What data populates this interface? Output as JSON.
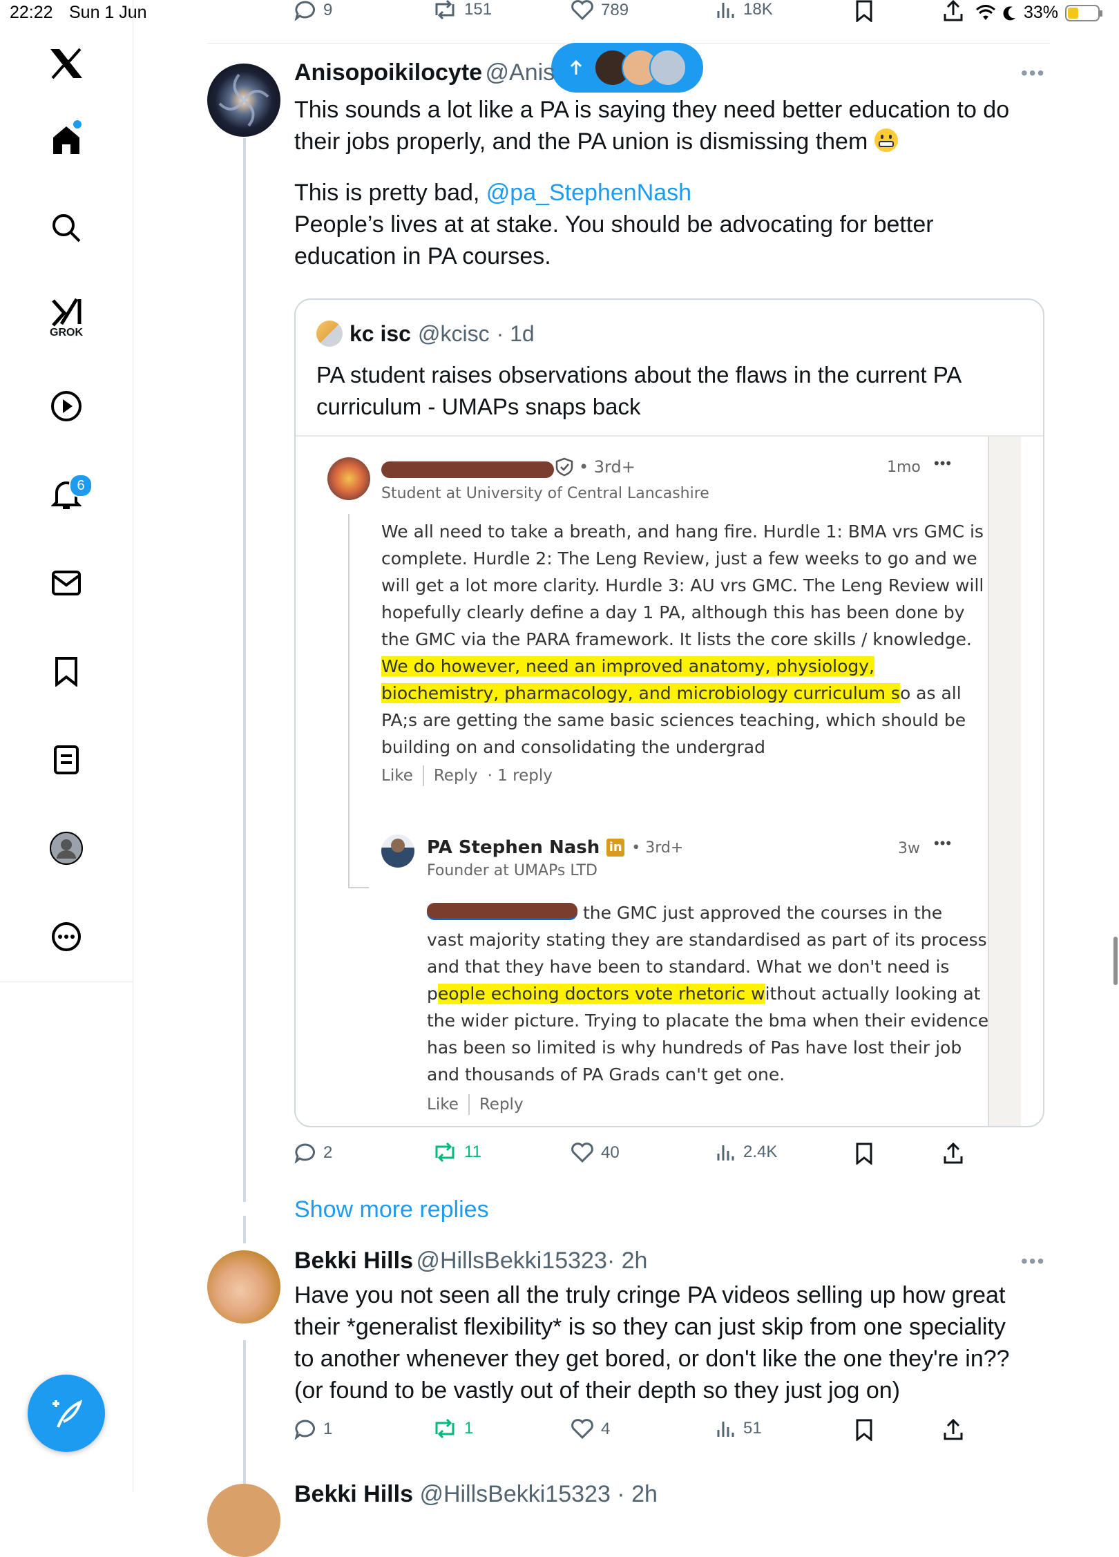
{
  "status_bar": {
    "time": "22:22",
    "date": "Sun 1 Jun",
    "battery": "33%",
    "battery_level": 0.33
  },
  "sidebar": {
    "items": [
      {
        "name": "home"
      },
      {
        "name": "search"
      },
      {
        "name": "grok",
        "label": "GROK"
      },
      {
        "name": "videos"
      },
      {
        "name": "notifications",
        "badge": "6"
      },
      {
        "name": "messages"
      },
      {
        "name": "bookmarks"
      },
      {
        "name": "lists"
      },
      {
        "name": "profile"
      },
      {
        "name": "more"
      }
    ]
  },
  "top_actions": {
    "replies": "9",
    "reposts": "151",
    "likes": "789",
    "views": "18K"
  },
  "tweet": {
    "name": "Anisopoikilocyte",
    "handle": "@Anis",
    "text_1": "This sounds a lot like a PA is saying they need better education to do",
    "text_2": "their jobs properly, and the PA union is dismissing them",
    "text_3_pre": "This is pretty bad, ",
    "mention": "@pa_StephenNash",
    "text_4": "People’s lives at at stake. You should be advocating for better",
    "text_5": "education in PA courses.",
    "actions": {
      "replies": "2",
      "reposts": "11",
      "likes": "40",
      "views": "2.4K"
    }
  },
  "quote": {
    "name": "kc isc",
    "handle": "@kcisc",
    "time": "· 1d",
    "text_1": "PA student raises observations about the flaws in the current PA",
    "text_2": "curriculum - UMAPs snaps back",
    "comment": {
      "degree": "• 3rd+",
      "time": "1mo",
      "headline": "Student at University of Central Lancashire",
      "lines": [
        "We all need to take a breath, and hang fire. Hurdle 1: BMA vrs GMC is",
        "complete. Hurdle 2: The Leng Review, just a few weeks to go and we",
        "will get a lot more clarity. Hurdle 3: AU vrs GMC. The Leng Review will",
        "hopefully clearly define a day 1 PA, although this has been done by",
        "the GMC via the PARA framework. It lists the core skills / knowledge."
      ],
      "hl_1": "We do however, need an improved anatomy, physiology,",
      "hl_2": "biochemistry, pharmacology, and microbiology curriculum s",
      "hl_2_rest": "o as all",
      "line_8": "PA;s are getting the same basic sciences teaching, which should be",
      "line_9": "building on and consolidating the undergrad",
      "like": "Like",
      "reply": "Reply",
      "reply_count": "· 1 reply"
    },
    "reply": {
      "name": "PA Stephen Nash",
      "degree": "• 3rd+",
      "time": "3w",
      "headline": "Founder at UMAPs LTD",
      "line_1": "the GMC just approved the courses in the",
      "line_2": "vast majority stating they are standardised as part of its process",
      "line_3": "and that they have been to standard. What we don't need is",
      "line_4_pre": "p",
      "line_4_hl": "eople echoing doctors vote rhetoric w",
      "line_4_post": "ithout actually looking at",
      "line_5": "the wider picture. Trying to placate the bma when their evidence",
      "line_6": "has been so limited is why hundreds of Pas have lost their job",
      "line_7": "and thousands of PA Grads can't get one.",
      "like": "Like",
      "reply": "Reply"
    }
  },
  "show_more": "Show more replies",
  "reply_tweet": {
    "name": "Bekki Hills",
    "handle": "@HillsBekki15323",
    "time": "· 2h",
    "line_1": "Have you not seen all the truly cringe PA videos selling up how great",
    "line_2": "their *generalist flexibility* is so they can just skip from one speciality",
    "line_3": "to another whenever they get bored, or don't like the one they're in??",
    "line_4": "(or found to be vastly out of their depth so they just jog on)",
    "actions": {
      "replies": "1",
      "reposts": "1",
      "likes": "4",
      "views": "51"
    }
  },
  "next_tweet": {
    "name": "Bekki Hills",
    "handle": "@HillsBekki15323 · 2h"
  },
  "colors": {
    "accent": "#1d9bf0",
    "repost_green": "#00ba7c",
    "highlight": "#fff200"
  }
}
